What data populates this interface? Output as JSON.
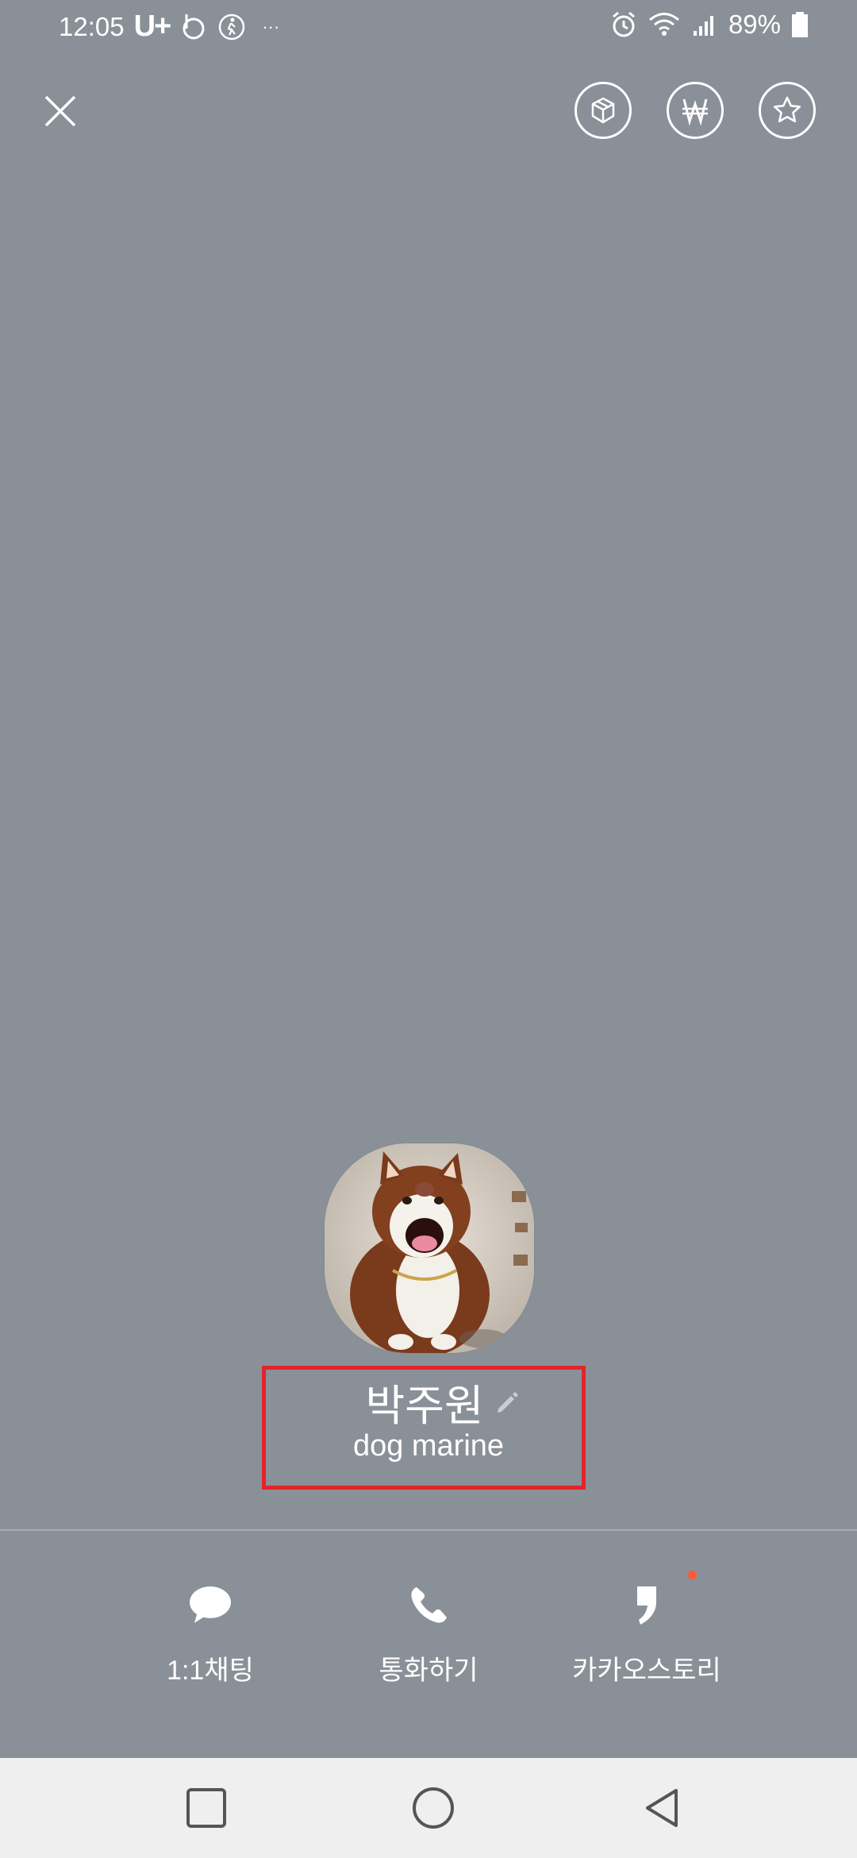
{
  "status_bar": {
    "time": "12:05",
    "carrier": "U+",
    "dots": "···",
    "battery": "89%"
  },
  "top_actions": {
    "close_icon": "close-icon",
    "gift_icon": "gift-box-icon",
    "pay_icon": "won-sign-icon",
    "favorite_icon": "star-icon"
  },
  "profile": {
    "name": "박주원",
    "status_message": "dog marine",
    "avatar_desc": "dog-photo",
    "highlight_color": "#e3242b"
  },
  "actions": [
    {
      "label": "1:1채팅",
      "icon": "chat-bubble-icon"
    },
    {
      "label": "통화하기",
      "icon": "phone-icon"
    },
    {
      "label": "카카오스토리",
      "icon": "kakaostory-icon",
      "has_new_dot": true
    }
  ],
  "nav_bar": {
    "recent_icon": "recent-apps-icon",
    "home_icon": "home-icon",
    "back_icon": "back-icon"
  },
  "colors": {
    "background": "#8a9098",
    "accent_dot": "#ff5a36",
    "nav_background": "#efefef"
  }
}
